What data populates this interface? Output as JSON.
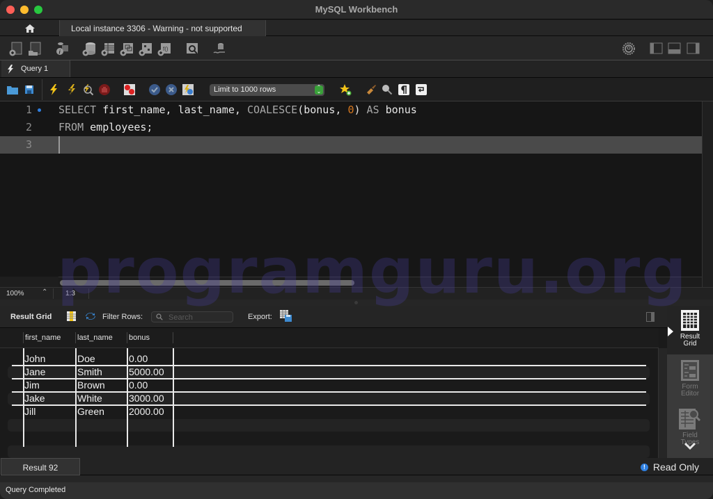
{
  "window": {
    "title": "MySQL Workbench"
  },
  "connection_tabs": {
    "home_icon": "home-icon",
    "active_tab": "Local instance 3306 - Warning - not supported"
  },
  "main_toolbar": {
    "icons": [
      "new-sql-tab-icon",
      "open-sql-file-icon",
      "server-info-icon",
      "create-schema-icon",
      "create-table-icon",
      "create-view-icon",
      "create-procedure-icon",
      "create-function-icon",
      "search-table-data-icon",
      "reconnect-icon"
    ],
    "right_icons": [
      "preferences-gear-icon",
      "toggle-sidebar-icon",
      "toggle-output-icon",
      "toggle-secondary-sidebar-icon"
    ]
  },
  "query_tabs": [
    {
      "label": "Query 1",
      "icon": "lightning-icon",
      "active": true
    }
  ],
  "sql_toolbar": {
    "icons": [
      "open-file-icon",
      "save-icon",
      "execute-icon",
      "execute-current-icon",
      "explain-icon",
      "stop-icon",
      "toggle-error-icon",
      "commit-icon",
      "rollback-icon",
      "autocommit-icon"
    ],
    "limit_select": "Limit to 1000 rows",
    "right_icons": [
      "add-snippet-icon",
      "beautify-icon",
      "find-icon",
      "invisible-chars-icon",
      "wrap-lines-icon"
    ]
  },
  "editor": {
    "lines": [
      {
        "number": "1",
        "tokens": [
          {
            "t": "SELECT",
            "k": "kw"
          },
          {
            "t": " first_name, last_name, ",
            "k": "id"
          },
          {
            "t": "COALESCE",
            "k": "kw"
          },
          {
            "t": "(bonus, ",
            "k": "id"
          },
          {
            "t": "0",
            "k": "num"
          },
          {
            "t": ") ",
            "k": "id"
          },
          {
            "t": "AS",
            "k": "kw"
          },
          {
            "t": " bonus",
            "k": "id"
          }
        ]
      },
      {
        "number": "2",
        "tokens": [
          {
            "t": "FROM",
            "k": "kw"
          },
          {
            "t": " employees;",
            "k": "id"
          }
        ]
      },
      {
        "number": "3",
        "tokens": []
      }
    ],
    "zoom": "100%",
    "cursor_position": "1:3"
  },
  "watermark": "programguru.org",
  "result_toolbar": {
    "result_grid_label": "Result Grid",
    "filter_label": "Filter Rows:",
    "search_placeholder": "Search",
    "export_label": "Export:"
  },
  "result_grid": {
    "columns": [
      "first_name",
      "last_name",
      "bonus"
    ],
    "rows": [
      [
        "John",
        "Doe",
        "0.00"
      ],
      [
        "Jane",
        "Smith",
        "5000.00"
      ],
      [
        "Jim",
        "Brown",
        "0.00"
      ],
      [
        "Jake",
        "White",
        "3000.00"
      ],
      [
        "Jill",
        "Green",
        "2000.00"
      ]
    ]
  },
  "side_panel": {
    "items": [
      {
        "label_1": "Result",
        "label_2": "Grid",
        "icon": "result-grid-icon",
        "active": true
      },
      {
        "label_1": "Form",
        "label_2": "Editor",
        "icon": "form-editor-icon",
        "active": false
      },
      {
        "label_1": "Field",
        "label_2": "Types",
        "icon": "field-types-icon",
        "active": false
      }
    ]
  },
  "result_tabs": {
    "active_tab": "Result 92",
    "read_only_label": "Read Only"
  },
  "status_bar": {
    "message": "Query Completed"
  },
  "colors": {
    "keyword": "#a8a8a8",
    "number": "#d6781f",
    "accent_blue": "#2f7fe0",
    "limit_arrows": "#3aa13a"
  }
}
